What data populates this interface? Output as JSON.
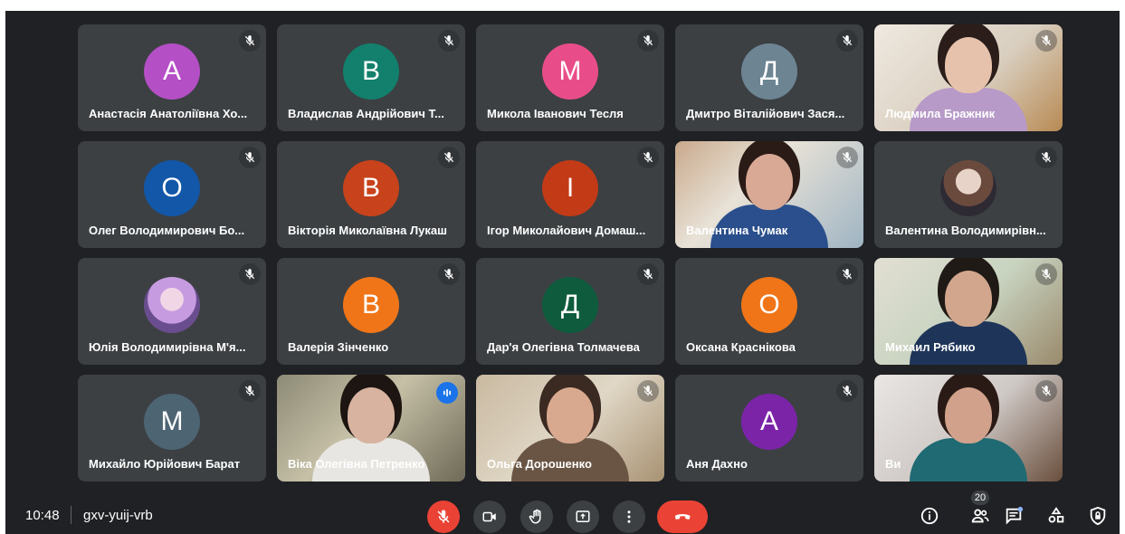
{
  "participants": [
    {
      "name": "Анастасія Анатоліївна Хо...",
      "initial": "А",
      "color": "#b44fc6",
      "type": "avatar"
    },
    {
      "name": "Владислав Андрійович Т...",
      "initial": "В",
      "color": "#12806c",
      "type": "avatar"
    },
    {
      "name": "Микола Іванович Тесля",
      "initial": "М",
      "color": "#e94d89",
      "type": "avatar"
    },
    {
      "name": "Дмитро Віталійович Зася...",
      "initial": "Д",
      "color": "#6d8493",
      "type": "avatar"
    },
    {
      "name": "Людмила Бражник",
      "type": "video"
    },
    {
      "name": "Олег Володимирович Бо...",
      "initial": "О",
      "color": "#1257a8",
      "type": "avatar"
    },
    {
      "name": "Вікторія Миколаївна Лукаш",
      "initial": "В",
      "color": "#c8421b",
      "type": "avatar"
    },
    {
      "name": "Ігор Миколайович Домаш...",
      "initial": "І",
      "color": "#c33a16",
      "type": "avatar"
    },
    {
      "name": "Валентина Чумак",
      "type": "video"
    },
    {
      "name": "Валентина Володимирівн...",
      "type": "photo-avatar"
    },
    {
      "name": "Юлія Володимирівна М'я...",
      "type": "photo-avatar"
    },
    {
      "name": "Валерія Зінченко",
      "initial": "В",
      "color": "#f07518",
      "type": "avatar"
    },
    {
      "name": "Дар'я Олегівна Толмачева",
      "initial": "Д",
      "color": "#0e5c3d",
      "type": "avatar"
    },
    {
      "name": "Оксана Краснікова",
      "initial": "О",
      "color": "#f07518",
      "type": "avatar"
    },
    {
      "name": "Михаил Рябико",
      "type": "video"
    },
    {
      "name": "Михайло Юрійович Барат",
      "initial": "М",
      "color": "#4d6473",
      "type": "avatar"
    },
    {
      "name": "Віка Олегівна Петренко",
      "type": "video",
      "speaking": true
    },
    {
      "name": "Ольга Дорошенко",
      "type": "video"
    },
    {
      "name": "Аня Дахно",
      "initial": "А",
      "color": "#7b24a8",
      "type": "avatar"
    },
    {
      "name": "Ви",
      "type": "video"
    }
  ],
  "bottom_bar": {
    "time": "10:48",
    "meeting_code": "gxv-yuij-vrb",
    "participant_count": "20",
    "icons": {
      "mic": "mic-off-icon",
      "camera": "camera-icon",
      "hand": "raise-hand-icon",
      "present": "present-screen-icon",
      "more": "more-options-icon",
      "leave": "leave-call-icon",
      "info": "info-icon",
      "people": "people-icon",
      "chat": "chat-icon",
      "activities": "activities-icon",
      "host": "host-controls-icon"
    }
  }
}
